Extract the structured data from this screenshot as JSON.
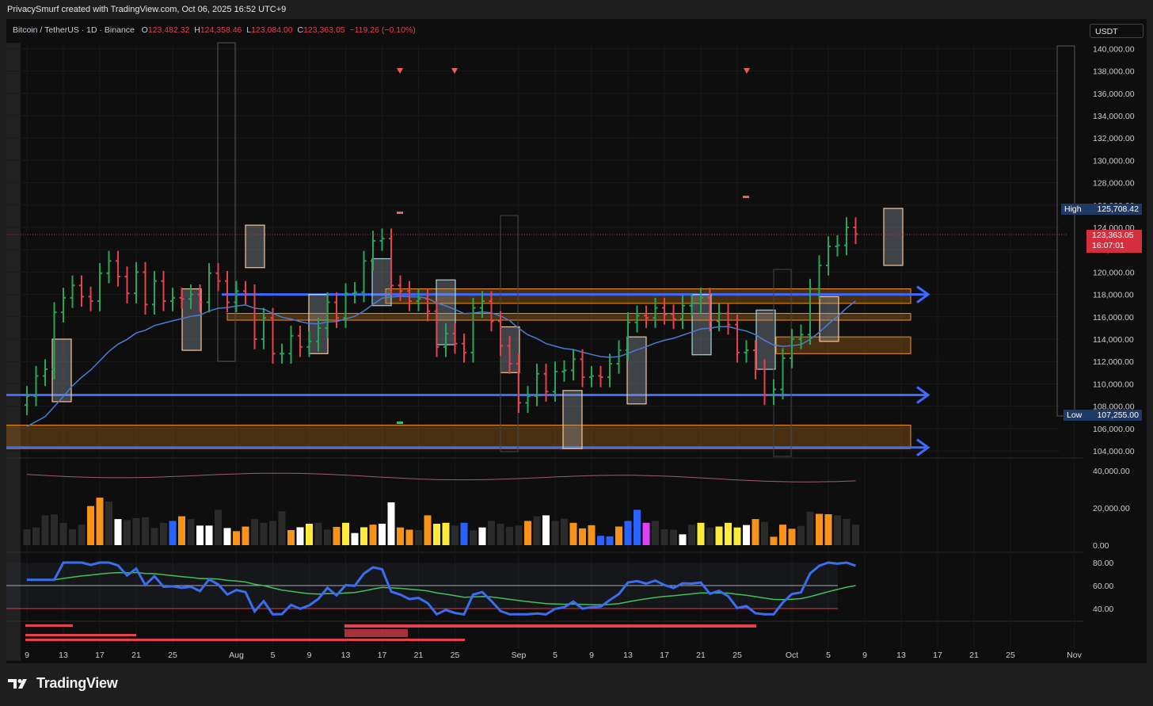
{
  "header": {
    "credit": "PrivacySmurf created with TradingView.com, Oct 06, 2025 16:52 UTC+9",
    "symbol": "Bitcoin / TetherUS · 1D · Binance",
    "o_label": "O",
    "o_value": "123,482.32",
    "h_label": "H",
    "h_value": "124,358.46",
    "l_label": "L",
    "l_value": "123,084.00",
    "c_label": "C",
    "c_value": "123,363.05",
    "change": "−119.26 (−0.10%)",
    "currency": "USDT"
  },
  "colors": {
    "up": "#26a65b",
    "down": "#e5414f",
    "ema": "#4a7bd6",
    "zone": "#f7931a",
    "hline": "#3d6bff",
    "tf": "#1e88e5",
    "vol_orange": "#f7931a",
    "vol_white": "#ffffff",
    "vol_blue": "#2962ff",
    "vol_yellow": "#ffeb3b",
    "vol_magenta": "#e040fb",
    "rsi": "#3a6df0",
    "rsi_ma": "#43c059"
  },
  "footer": {
    "brand": "TradingView"
  },
  "chart_data": [
    {
      "type": "candlestick",
      "title": "Bitcoin / TetherUS · 1D · Binance",
      "ylim": [
        103000,
        141000
      ],
      "y_ticks": [
        104000,
        106000,
        108000,
        110000,
        112000,
        114000,
        116000,
        118000,
        120000,
        122000,
        124000,
        126000,
        128000,
        130000,
        132000,
        134000,
        136000,
        138000,
        140000
      ],
      "y_tick_labels": [
        "104,000.00",
        "106,000.00",
        "108,000.00",
        "110,000.00",
        "112,000.00",
        "114,000.00",
        "116,000.00",
        "118,000.00",
        "120,000.00",
        "122,000.00",
        "124,000.00",
        "126,000.00",
        "128,000.00",
        "130,000.00",
        "132,000.00",
        "134,000.00",
        "136,000.00",
        "138,000.00",
        "140,000.00"
      ],
      "x_ticks": [
        {
          "day": 0,
          "label": "9"
        },
        {
          "day": 4,
          "label": "13"
        },
        {
          "day": 8,
          "label": "17"
        },
        {
          "day": 12,
          "label": "21"
        },
        {
          "day": 16,
          "label": "25"
        },
        {
          "day": 23,
          "label": "Aug"
        },
        {
          "day": 27,
          "label": "5"
        },
        {
          "day": 31,
          "label": "9"
        },
        {
          "day": 35,
          "label": "13"
        },
        {
          "day": 39,
          "label": "17"
        },
        {
          "day": 43,
          "label": "21"
        },
        {
          "day": 47,
          "label": "25"
        },
        {
          "day": 54,
          "label": "Sep"
        },
        {
          "day": 58,
          "label": "5"
        },
        {
          "day": 62,
          "label": "9"
        },
        {
          "day": 66,
          "label": "13"
        },
        {
          "day": 70,
          "label": "17"
        },
        {
          "day": 74,
          "label": "21"
        },
        {
          "day": 78,
          "label": "25"
        },
        {
          "day": 84,
          "label": "Oct"
        },
        {
          "day": 88,
          "label": "5"
        },
        {
          "day": 92,
          "label": "9"
        },
        {
          "day": 96,
          "label": "13"
        },
        {
          "day": 100,
          "label": "17"
        },
        {
          "day": 104,
          "label": "21"
        },
        {
          "day": 108,
          "label": "25"
        },
        {
          "day": 115,
          "label": "Nov"
        }
      ],
      "closes": [
        108900,
        110700,
        111300,
        116400,
        117700,
        118800,
        117800,
        117400,
        119900,
        121000,
        119600,
        118100,
        120000,
        117100,
        119200,
        117400,
        117700,
        117600,
        118000,
        117300,
        119900,
        119200,
        117300,
        118300,
        118000,
        114000,
        115900,
        112700,
        112700,
        114300,
        113300,
        113800,
        115000,
        117300,
        115900,
        118100,
        118200,
        121000,
        122800,
        123000,
        118800,
        118300,
        117400,
        117600,
        116500,
        113300,
        114500,
        113600,
        112800,
        116800,
        117400,
        115600,
        113400,
        111800,
        108300,
        108900,
        110900,
        109300,
        111100,
        111200,
        112200,
        110600,
        110700,
        110600,
        111800,
        113000,
        115500,
        116100,
        115900,
        116800,
        116200,
        115800,
        117000,
        117200,
        117700,
        115600,
        116300,
        115300,
        112800,
        113000,
        111300,
        109000,
        109500,
        112300,
        114000,
        114400,
        118500,
        120600,
        122300,
        122400,
        124000,
        123400
      ],
      "volumes": [
        8500,
        9500,
        16000,
        16500,
        12000,
        8500,
        11000,
        21000,
        25500,
        23500,
        14000,
        13500,
        14500,
        15000,
        9200,
        12000,
        13000,
        15500,
        14000,
        10500,
        10500,
        19000,
        9200,
        7500,
        10000,
        14000,
        12000,
        13000,
        18200,
        8100,
        9600,
        11500,
        12000,
        8400,
        9800,
        12000,
        6500,
        9600,
        11000,
        11500,
        23000,
        9500,
        8300,
        8100,
        16000,
        11500,
        12000,
        10500,
        12000,
        8000,
        9500,
        13000,
        11500,
        9800,
        10500,
        13000,
        15500,
        16000,
        13000,
        14200,
        12000,
        9000,
        10700,
        5000,
        4700,
        10000,
        13000,
        19000,
        12000,
        13000,
        8500,
        8300,
        5800,
        11000,
        12000,
        9400,
        10000,
        12000,
        9500,
        10800,
        14000,
        12500,
        4500,
        11000,
        8800,
        10300,
        18000,
        16800,
        16600,
        16000,
        14100,
        11000
      ],
      "volume_colors": {
        "orange": [
          7,
          8,
          17,
          23,
          24,
          29,
          34,
          38,
          41,
          42,
          44,
          55,
          60,
          61,
          62,
          65,
          66,
          67,
          80,
          82,
          83,
          84,
          87,
          88
        ],
        "white": [
          10,
          19,
          20,
          22,
          30,
          36,
          39,
          40,
          48,
          50,
          57,
          72,
          79
        ],
        "blue": [
          16,
          48,
          63,
          64,
          66,
          67
        ],
        "yellow": [
          31,
          35,
          37,
          45,
          46,
          74,
          76,
          77,
          78
        ],
        "magenta": [
          68
        ]
      },
      "rsi_pane": {
        "y_ticks": [
          40,
          60,
          80
        ],
        "y_tick_labels": [
          "40.00",
          "60.00",
          "80.00"
        ],
        "ylim": [
          30,
          90
        ]
      },
      "volume_pane": {
        "y_ticks": [
          0,
          20000,
          40000
        ],
        "y_tick_labels": [
          "0.00",
          "20,000.00",
          "40,000.00"
        ],
        "ylim": [
          0,
          45000
        ]
      }
    }
  ],
  "price_tags": {
    "high_label": "High",
    "high_value": "125,708.42",
    "last_value": "123,363.05",
    "countdown": "16:07:01",
    "low_label": "Low",
    "low_value": "107,255.00"
  }
}
